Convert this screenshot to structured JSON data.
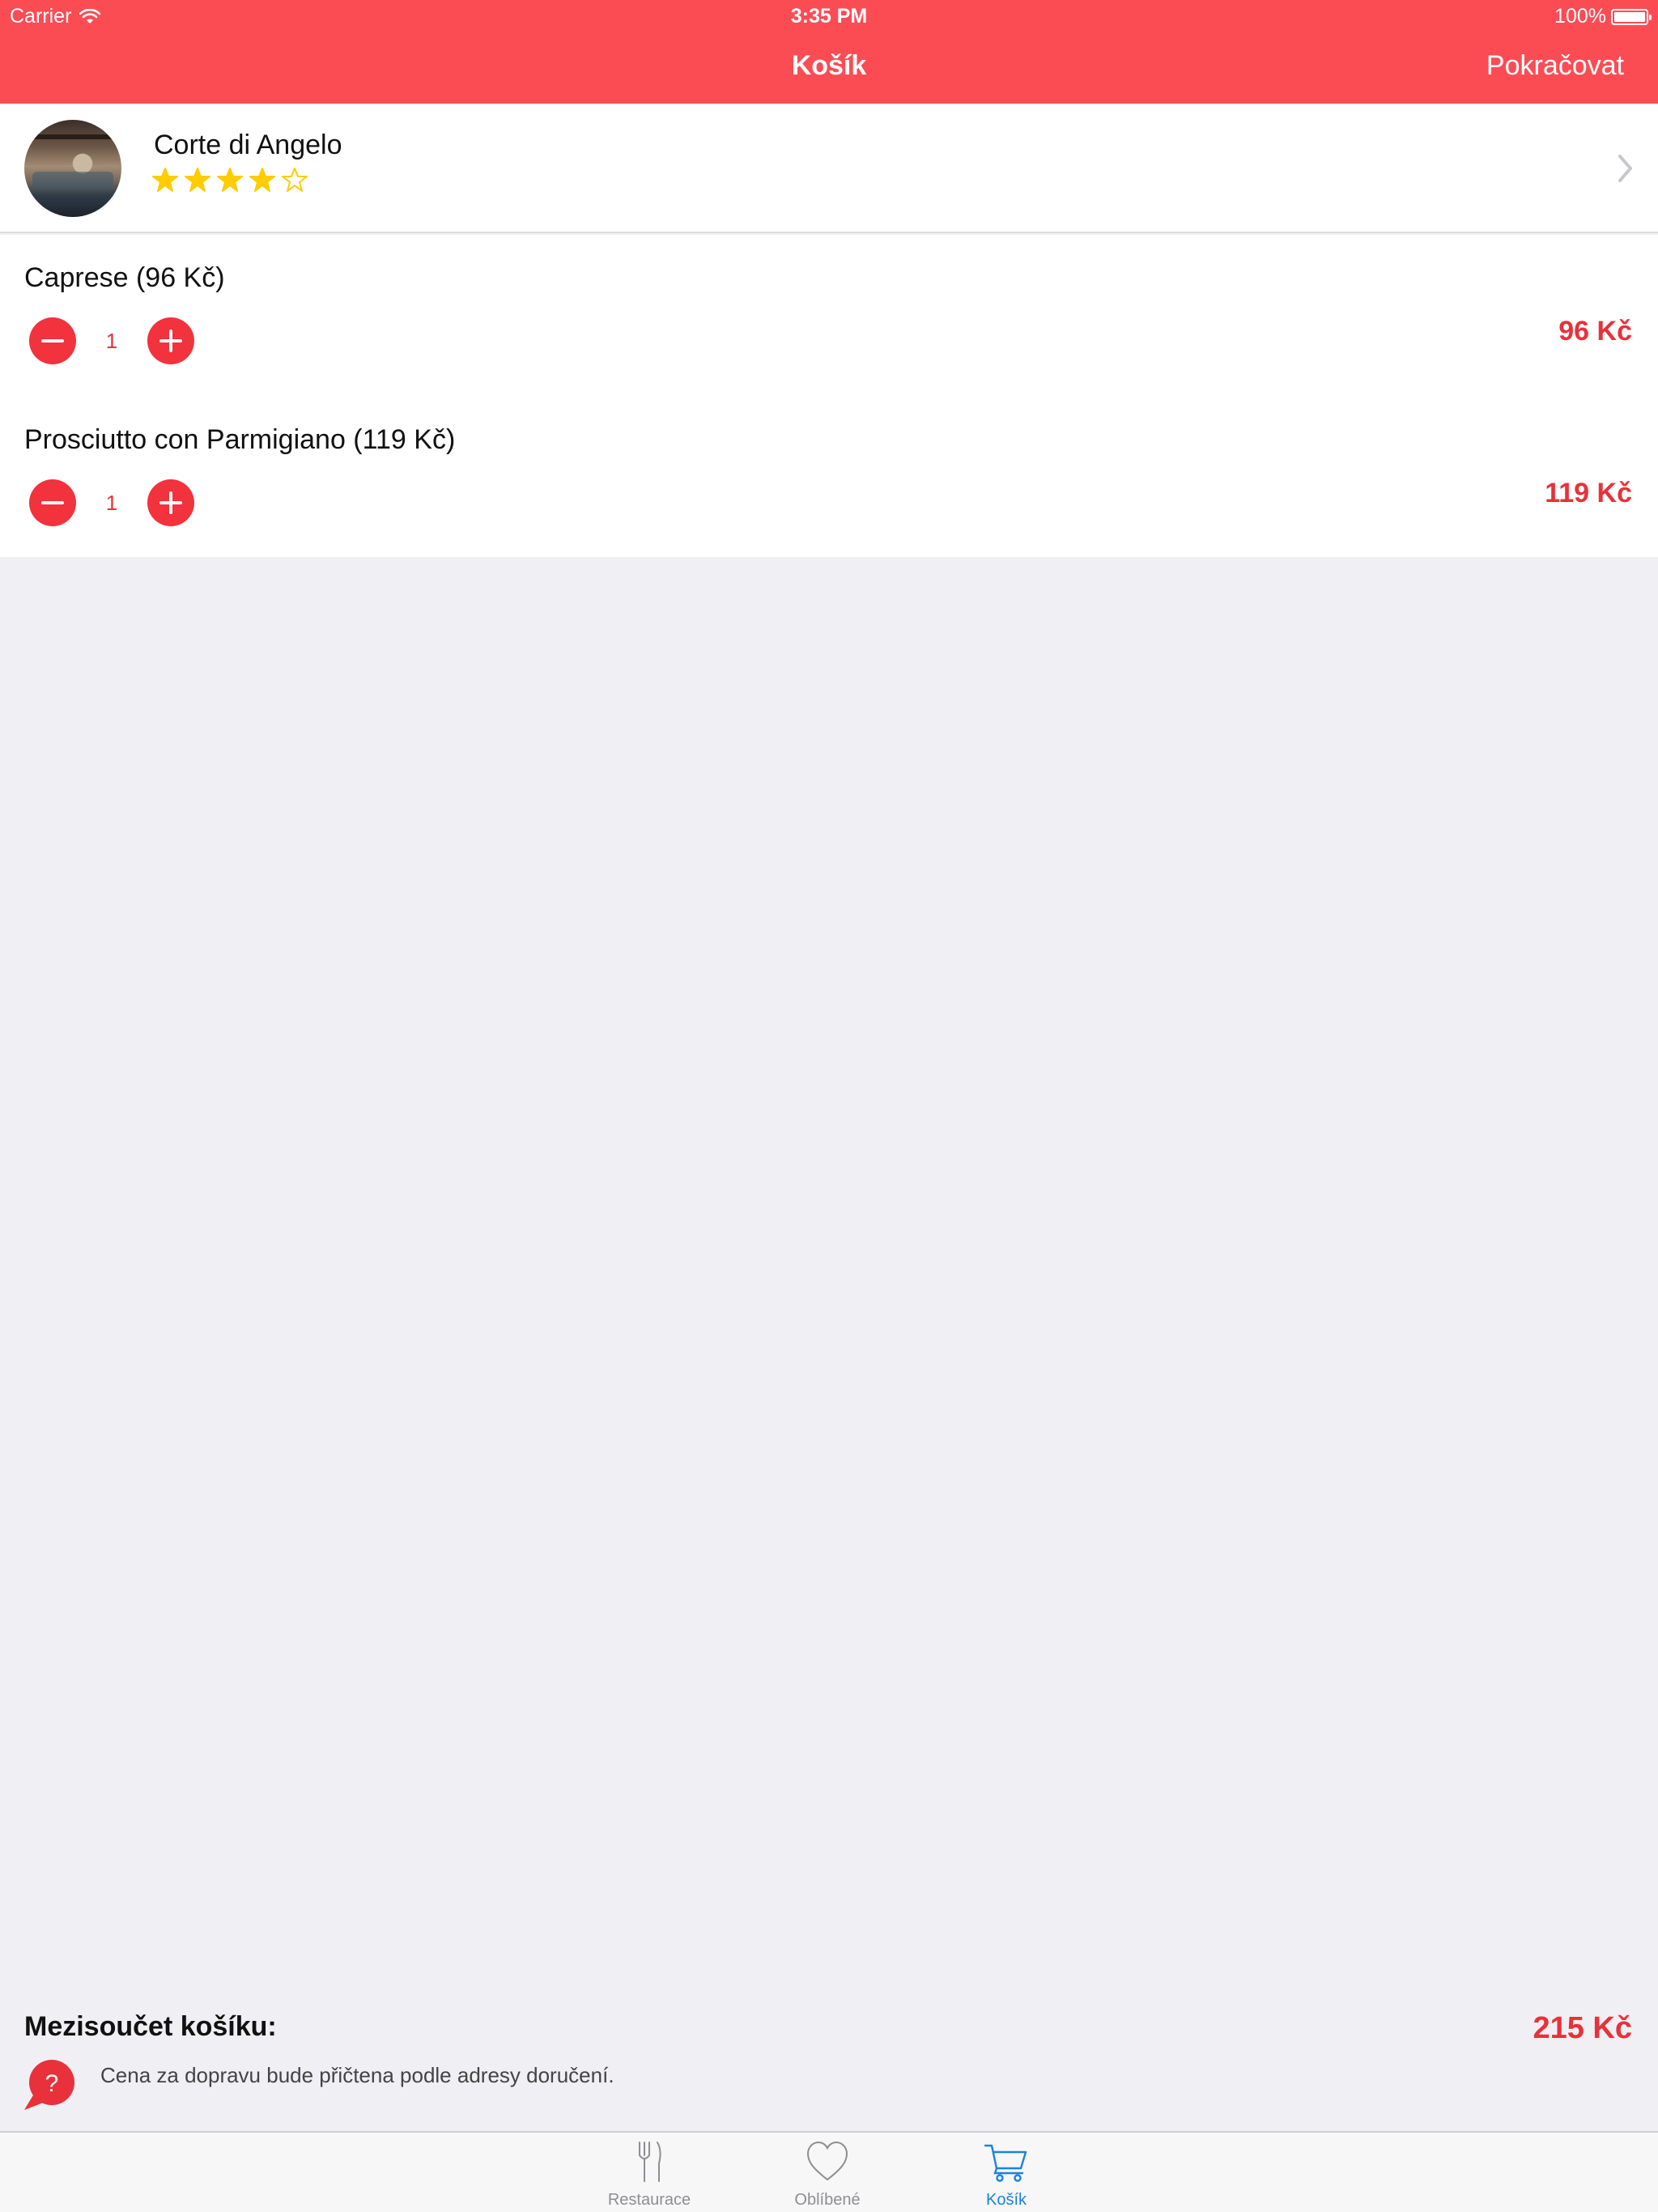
{
  "status_bar": {
    "carrier": "Carrier",
    "time": "3:35 PM",
    "battery": "100%",
    "battery_level": 1.0
  },
  "nav": {
    "title": "Košík",
    "action": "Pokračovat"
  },
  "restaurant": {
    "name": "Corte di Angelo",
    "rating": 4,
    "rating_max": 5
  },
  "cart": {
    "items": [
      {
        "name": "Caprese (96 Kč)",
        "quantity": "1",
        "price": "96 Kč"
      },
      {
        "name": "Prosciutto con Parmigiano (119 Kč)",
        "quantity": "1",
        "price": "119 Kč"
      }
    ],
    "subtotal_label": "Mezisoučet košíku:",
    "subtotal_value": "215 Kč",
    "delivery_note": "Cena za dopravu bude přičtena podle adresy doručení."
  },
  "tabs": [
    {
      "label": "Restaurace",
      "icon": "fork-knife-icon",
      "active": false
    },
    {
      "label": "Oblíbené",
      "icon": "heart-icon",
      "active": false
    },
    {
      "label": "Košík",
      "icon": "cart-icon",
      "active": true
    }
  ],
  "colors": {
    "brand": "#fb4c54",
    "accent_red": "#e8313a",
    "star": "#ffcc00",
    "tab_active": "#1a82e2"
  }
}
